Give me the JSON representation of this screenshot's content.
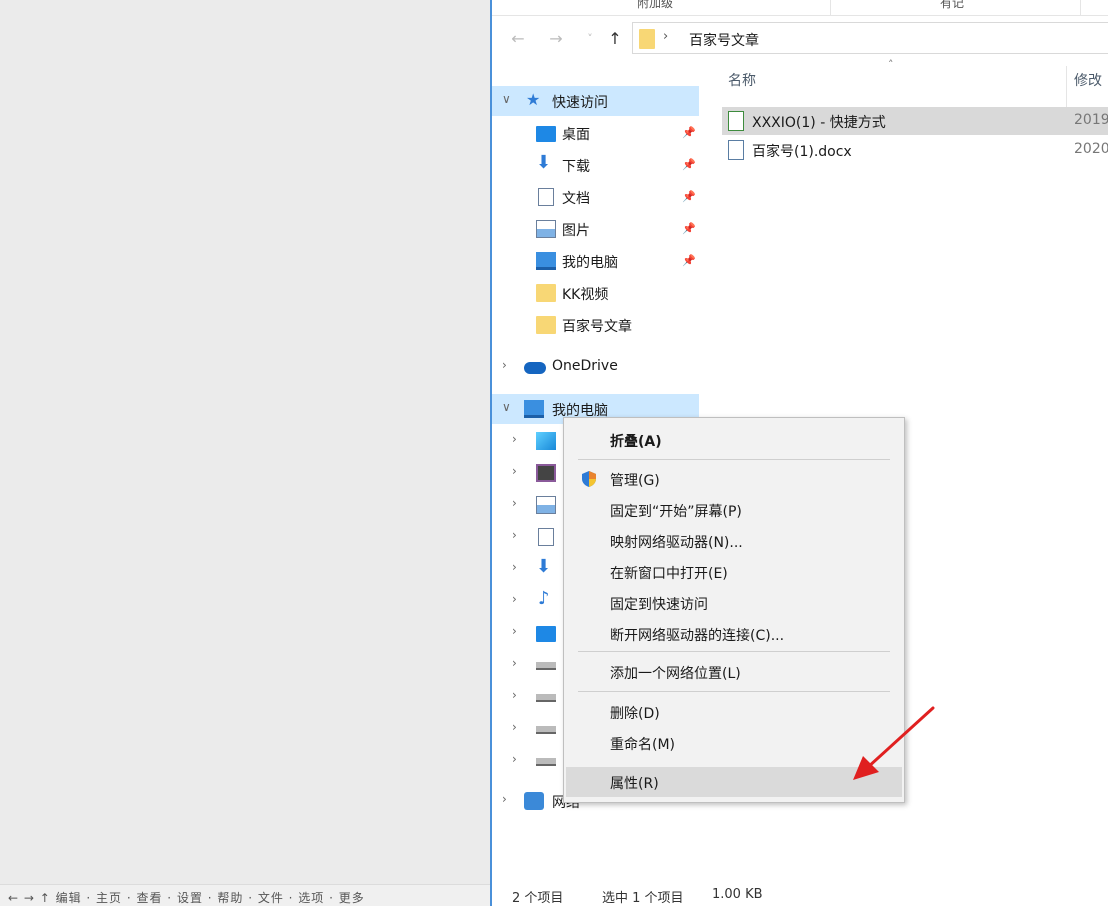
{
  "left_pane": {
    "status_text": "← → ↑ 编辑 · 主页 · 查看 · 设置 · 帮助 · 文件 · 选项 · 更多"
  },
  "header": {
    "tab_left": "附加级",
    "tab_right": "有记"
  },
  "address_bar": {
    "path": "百家号文章",
    "chevron": "›"
  },
  "nav_buttons": {
    "back": "←",
    "forward": "→",
    "recent": "˅",
    "up": "↑"
  },
  "navigation": {
    "quick_access": "快速访问",
    "quick_items": [
      {
        "label": "桌面",
        "icon": "desktop-icon"
      },
      {
        "label": "下载",
        "icon": "download-icon"
      },
      {
        "label": "文档",
        "icon": "document-icon"
      },
      {
        "label": "图片",
        "icon": "picture-icon"
      },
      {
        "label": "我的电脑",
        "icon": "computer-icon"
      },
      {
        "label": "KK视频",
        "icon": "folder-icon"
      },
      {
        "label": "百家号文章",
        "icon": "folder-icon"
      }
    ],
    "onedrive": "OneDrive",
    "this_pc": "我的电脑",
    "network": "网络",
    "pin_glyph": "📌",
    "expanded_glyph": "∨",
    "collapsed_glyph": "›"
  },
  "file_list": {
    "columns": {
      "name": "名称",
      "modified": "修改"
    },
    "sort_glyph": "˄",
    "files": [
      {
        "name": "XXXIO(1) - 快捷方式",
        "date": "2019",
        "icon": "shortcut-file-icon"
      },
      {
        "name": "百家号(1).docx",
        "date": "2020",
        "icon": "word-document-icon"
      }
    ]
  },
  "context_menu": {
    "items": [
      {
        "label": "折叠(A)",
        "bold": true
      },
      {
        "label": "管理(G)",
        "icon": "shield-icon"
      },
      {
        "label": "固定到“开始”屏幕(P)"
      },
      {
        "label": "映射网络驱动器(N)..."
      },
      {
        "label": "在新窗口中打开(E)"
      },
      {
        "label": "固定到快速访问"
      },
      {
        "label": "断开网络驱动器的连接(C)..."
      },
      {
        "label": "添加一个网络位置(L)"
      },
      {
        "label": "删除(D)"
      },
      {
        "label": "重命名(M)"
      },
      {
        "label": "属性(R)",
        "hovered": true
      }
    ]
  },
  "status_bar": {
    "item_count": "2 个项目",
    "selected": "选中 1 个项目",
    "size": "1.00 KB"
  },
  "colors": {
    "selection": "#cce8ff",
    "accent": "#4a90d9",
    "annotation_arrow": "#e02020"
  }
}
